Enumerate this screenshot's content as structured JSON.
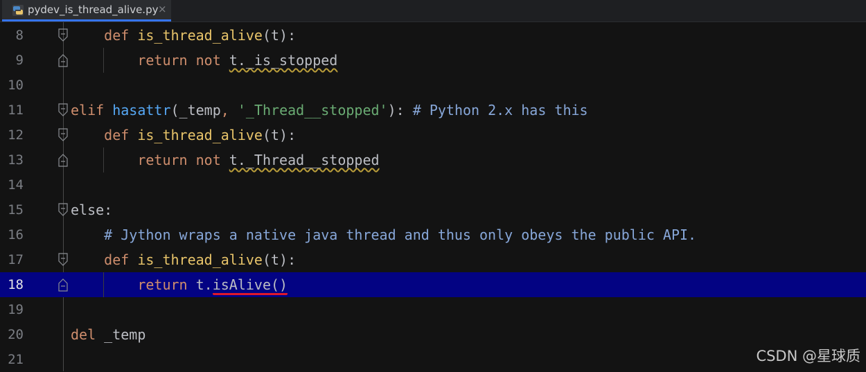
{
  "tab": {
    "filename": "pydev_is_thread_alive.py",
    "close_glyph": "×",
    "icon": "python-file-icon"
  },
  "colors": {
    "accent": "#3574f0",
    "current_line": "#030383",
    "keyword": "#cf8e6d",
    "function": "#56a8f5"
  },
  "lines": [
    {
      "n": "8",
      "parts": [
        [
          "    ",
          ""
        ],
        [
          "def ",
          "kw"
        ],
        [
          "is_thread_alive",
          "yel"
        ],
        [
          "(t):",
          ""
        ]
      ]
    },
    {
      "n": "9",
      "parts": [
        [
          "        ",
          ""
        ],
        [
          "return ",
          "kw"
        ],
        [
          "not ",
          "kw"
        ],
        [
          "t._is_stopped",
          "warn"
        ]
      ]
    },
    {
      "n": "10",
      "parts": []
    },
    {
      "n": "11",
      "parts": [
        [
          "elif ",
          "kw"
        ],
        [
          "hasattr",
          "fn"
        ],
        [
          "(_temp",
          ""
        ],
        [
          ", ",
          "kw"
        ],
        [
          "'_Thread__stopped'",
          "str"
        ],
        [
          "): ",
          ""
        ],
        [
          "# Python 2.x has this",
          "cmtb"
        ]
      ]
    },
    {
      "n": "12",
      "parts": [
        [
          "    ",
          ""
        ],
        [
          "def ",
          "kw"
        ],
        [
          "is_thread_alive",
          "yel"
        ],
        [
          "(t):",
          ""
        ]
      ]
    },
    {
      "n": "13",
      "parts": [
        [
          "        ",
          ""
        ],
        [
          "return ",
          "kw"
        ],
        [
          "not ",
          "kw"
        ],
        [
          "t._Thread__stopped",
          "warn"
        ]
      ]
    },
    {
      "n": "14",
      "parts": []
    },
    {
      "n": "15",
      "parts": [
        [
          "else",
          ""
        ],
        [
          ":",
          ""
        ]
      ]
    },
    {
      "n": "16",
      "parts": [
        [
          "    ",
          ""
        ],
        [
          "# Jython wraps a native java thread and thus only obeys the public API.",
          "cmtb"
        ]
      ]
    },
    {
      "n": "17",
      "parts": [
        [
          "    ",
          ""
        ],
        [
          "def ",
          "kw"
        ],
        [
          "is_thread_alive",
          "yel"
        ],
        [
          "(t):",
          ""
        ]
      ]
    },
    {
      "n": "18",
      "parts": [
        [
          "        ",
          ""
        ],
        [
          "return ",
          "kw"
        ],
        [
          "t.",
          ""
        ],
        [
          "isAlive()",
          "err"
        ]
      ]
    },
    {
      "n": "19",
      "parts": []
    },
    {
      "n": "20",
      "parts": [
        [
          "del ",
          "kw"
        ],
        [
          "_temp",
          ""
        ]
      ]
    },
    {
      "n": "21",
      "parts": []
    }
  ],
  "current_line": "18",
  "watermark": "CSDN @星球质"
}
